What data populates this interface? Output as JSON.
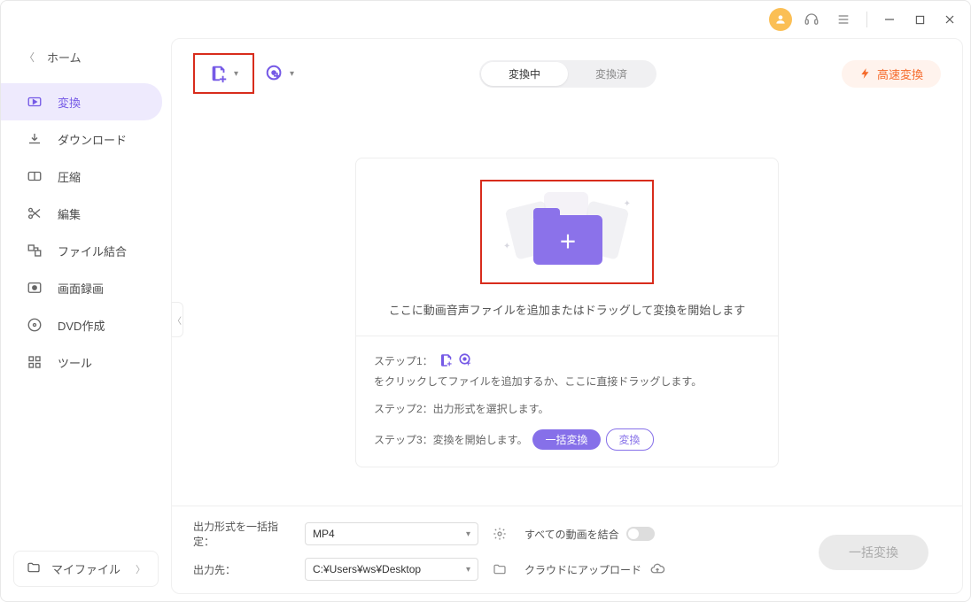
{
  "titlebar": {
    "user_icon": "user",
    "headset_icon": "headset",
    "menu_icon": "menu"
  },
  "sidebar": {
    "home_label": "ホーム",
    "items": [
      {
        "label": "変換",
        "icon": "convert"
      },
      {
        "label": "ダウンロード",
        "icon": "download"
      },
      {
        "label": "圧縮",
        "icon": "compress"
      },
      {
        "label": "編集",
        "icon": "edit"
      },
      {
        "label": "ファイル結合",
        "icon": "merge"
      },
      {
        "label": "画面録画",
        "icon": "record"
      },
      {
        "label": "DVD作成",
        "icon": "dvd"
      },
      {
        "label": "ツール",
        "icon": "tools"
      }
    ],
    "my_files_label": "マイファイル"
  },
  "toolbar": {
    "tabs": {
      "converting": "変換中",
      "converted": "変換済"
    },
    "fast_convert_label": "高速変換"
  },
  "dropzone": {
    "main_text": "ここに動画音声ファイルを追加またはドラッグして変換を開始します",
    "step1_prefix": "ステップ1：",
    "step1_suffix": "をクリックしてファイルを追加するか、ここに直接ドラッグします。",
    "step2": "ステップ2：出力形式を選択します。",
    "step3": "ステップ3：変換を開始します。",
    "batch_convert_label": "一括変換",
    "convert_label": "変換"
  },
  "bottom": {
    "format_label": "出力形式を一括指定：",
    "format_value": "MP4",
    "dest_label": "出力先：",
    "dest_value": "C:¥Users¥ws¥Desktop",
    "merge_label": "すべての動画を結合",
    "cloud_label": "クラウドにアップロード",
    "batch_button_label": "一括変換"
  }
}
